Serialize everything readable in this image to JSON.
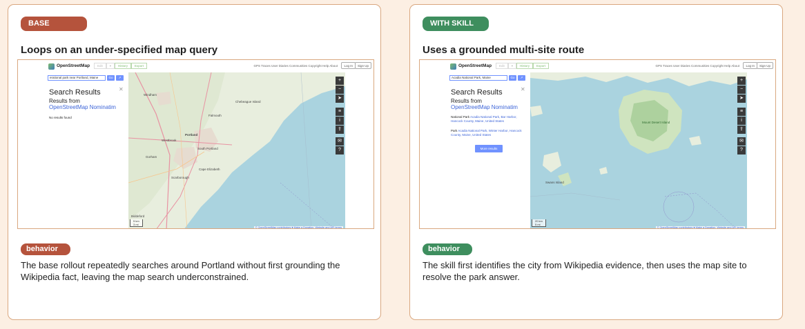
{
  "left": {
    "pill": "BASE",
    "pill_color": "#b5533c",
    "title": "Loops on an under-specified map query",
    "behavior_label": "behavior",
    "description": "The base rollout repeatedly searches around Portland without first grounding the Wikipedia fact, leaving the map search underconstrained.",
    "screenshot": {
      "brand": "OpenStreetMap",
      "tabs": [
        "Edit",
        "▾",
        "History",
        "Export"
      ],
      "nav_links": "GPS Traces  User Diaries  Communities  Copyright  Help  About",
      "login": "Log In",
      "signup": "Sign Up",
      "search_value": "erational park near Portland, Maine",
      "go": "Go",
      "go2": "↗",
      "results_title": "Search Results",
      "results_from": "Results from",
      "results_source": "OpenStreetMap Nominatim",
      "no_results": "No results found",
      "places": [
        "Westbrook",
        "Portland",
        "South Portland",
        "Cape Elizabeth",
        "Windham",
        "Falmouth",
        "Gorham",
        "Scarborough",
        "Biddeford",
        "Chebeague Island"
      ],
      "scale": [
        "5 km",
        "3 mi"
      ],
      "attribution": "© OpenStreetMap contributors ♥ Make a Donation. Website and API terms"
    }
  },
  "right": {
    "pill": "WITH SKILL",
    "pill_color": "#3e8e5e",
    "title": "Uses a grounded multi-site route",
    "behavior_label": "behavior",
    "description": "The skill first identifies the city from Wikipedia evidence, then uses the map site to resolve the park answer.",
    "screenshot": {
      "brand": "OpenStreetMap",
      "tabs": [
        "Edit",
        "▾",
        "History",
        "Export"
      ],
      "nav_links": "GPS Traces  User Diaries  Communities  Copyright  Help  About",
      "login": "Log In",
      "signup": "Sign Up",
      "search_value": "Acadia National Park, Maine",
      "go": "Go",
      "go2": "↗",
      "results_title": "Search Results",
      "results_from": "Results from",
      "results_source": "OpenStreetMap Nominatim",
      "result1_type": "National Park",
      "result1_link": "Acadia National Park, Bar Harbor, Hancock County, Maine, United States",
      "result2_type": "Park",
      "result2_link": "Acadia National Park, Winter Harbor, Hancock County, Maine, United States",
      "more": "More results",
      "places": [
        "Mount Desert Island",
        "Swans Island"
      ],
      "scale": [
        "20 km",
        "5 mi"
      ],
      "attribution": "© OpenStreetMap contributors ♥ Make a Donation. Website and API terms"
    }
  },
  "map_controls": [
    "+",
    "−",
    "➤",
    "≡",
    "i",
    "⇪",
    "✉",
    "?"
  ],
  "colors": {
    "background": "#fcefe3",
    "border": "#d9a77f",
    "water": "#aad3df",
    "land": "#f2efe9",
    "link": "#3c64d8"
  }
}
